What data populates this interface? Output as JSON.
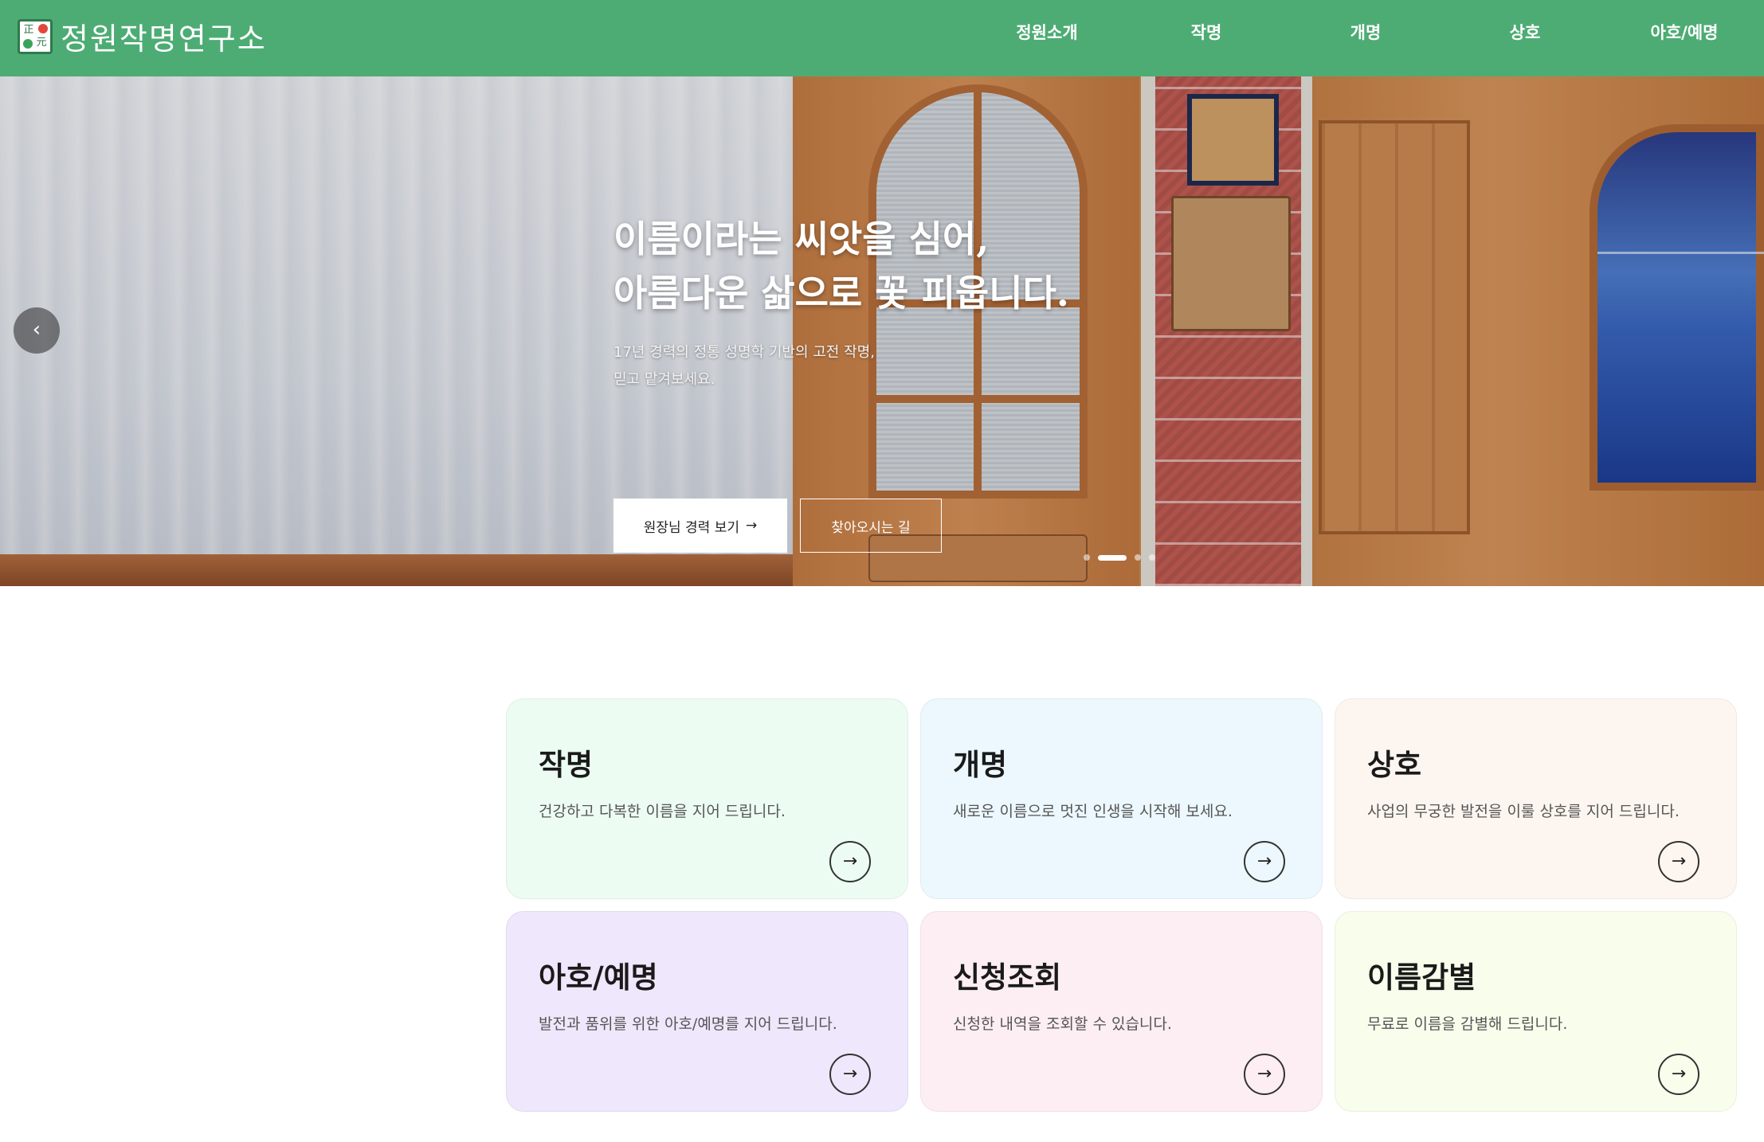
{
  "header": {
    "logo_text": "정원작명연구소",
    "logo_glyph_top": "正",
    "logo_glyph_bottom": "元",
    "nav": [
      {
        "label": "정원소개"
      },
      {
        "label": "작명"
      },
      {
        "label": "개명"
      },
      {
        "label": "상호"
      },
      {
        "label": "아호/예명"
      }
    ],
    "background_color": "#4dac74"
  },
  "hero": {
    "title_line1": "이름이라는 씨앗을 심어,",
    "title_line2": "아름다운 삶으로 꽃 피웁니다.",
    "subtitle_line1": "17년 경력의 정통 성명학 기반의 고전 작명,",
    "subtitle_line2": "믿고 맡겨보세요.",
    "primary_button": "원장님 경력 보기",
    "primary_button_arrow": "→",
    "secondary_button": "찾아오시는 길",
    "prev_arrow": "‹",
    "slide_count": 3,
    "active_slide": 1
  },
  "cards": [
    {
      "title": "작명",
      "desc": "건강하고 다복한 이름을 지어 드립니다.",
      "bg": "#ecfcf3",
      "arrow": "→"
    },
    {
      "title": "개명",
      "desc": "새로운 이름으로 멋진 인생을 시작해 보세요.",
      "bg": "#ecf8fd",
      "arrow": "→"
    },
    {
      "title": "상호",
      "desc": "사업의 무궁한 발전을 이룰 상호를 지어 드립니다.",
      "bg": "#fdf6f0",
      "arrow": "→"
    },
    {
      "title": "아호/예명",
      "desc": "발전과 품위를 위한 아호/예명를 지어 드립니다.",
      "bg": "#efe7fc",
      "arrow": "→"
    },
    {
      "title": "신청조회",
      "desc": "신청한 내역을 조회할 수 있습니다.",
      "bg": "#fdeef4",
      "arrow": "→"
    },
    {
      "title": "이름감별",
      "desc": "무료로 이름을 감별해 드립니다.",
      "bg": "#f8fdec",
      "arrow": "→"
    }
  ]
}
